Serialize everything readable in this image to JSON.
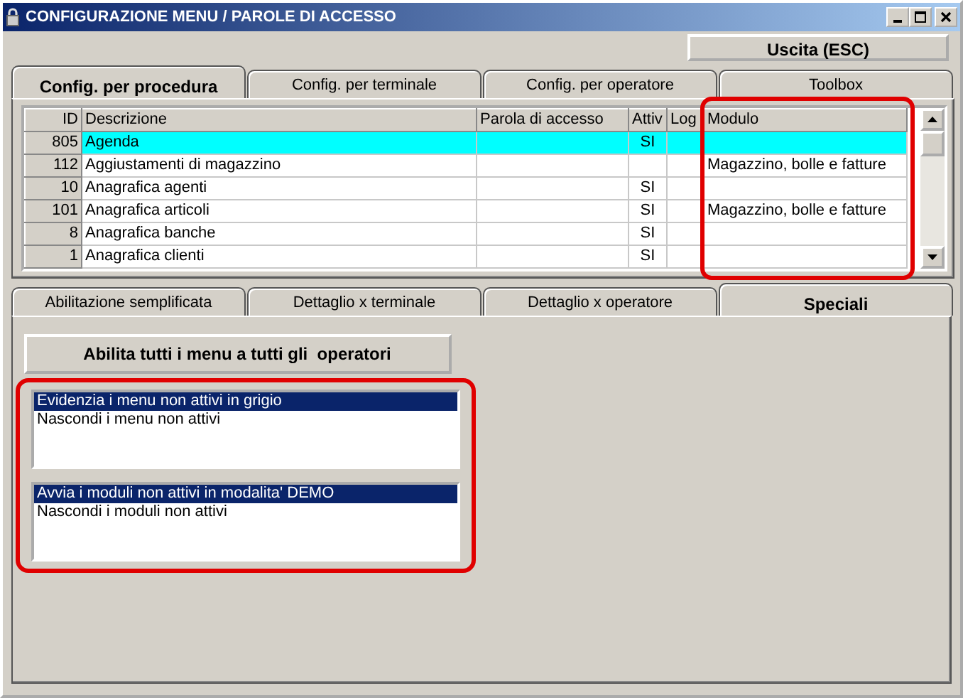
{
  "window": {
    "title": "CONFIGURAZIONE MENU / PAROLE DI ACCESSO"
  },
  "exit_button": {
    "label": "Uscita (ESC)"
  },
  "tabs": [
    {
      "label": "Config. per procedura",
      "selected": true
    },
    {
      "label": "Config. per terminale",
      "selected": false
    },
    {
      "label": "Config. per operatore",
      "selected": false
    },
    {
      "label": "Toolbox",
      "selected": false
    }
  ],
  "table": {
    "columns": [
      {
        "label": "ID",
        "highlighted": false
      },
      {
        "label": "Descrizione",
        "highlighted": false
      },
      {
        "label": "Parola di accesso",
        "highlighted": false
      },
      {
        "label": "Attiv",
        "highlighted": false
      },
      {
        "label": "Log",
        "highlighted": false
      },
      {
        "label": "Modulo",
        "highlighted": true
      }
    ],
    "rows": [
      {
        "id": "805",
        "description": "Agenda",
        "active": "SI",
        "selected": true
      },
      {
        "id": "112",
        "description": "Aggiustamenti di magazzino",
        "module": "Magazzino, bolle e fatture",
        "selected": false
      },
      {
        "id": "10",
        "description": "Anagrafica agenti",
        "active": "SI",
        "selected": false
      },
      {
        "id": "101",
        "description": "Anagrafica articoli",
        "active": "SI",
        "module": "Magazzino, bolle e fatture",
        "selected": false
      },
      {
        "id": "8",
        "description": "Anagrafica banche",
        "active": "SI",
        "selected": false
      },
      {
        "id": "1",
        "description": "Anagrafica clienti",
        "active": "SI",
        "selected": false
      }
    ]
  },
  "sub_tabs": [
    {
      "label": "Abilitazione semplificata",
      "selected": false
    },
    {
      "label": "Dettaglio x terminale",
      "selected": false
    },
    {
      "label": "Dettaglio x operatore",
      "selected": false
    },
    {
      "label": "Speciali",
      "selected": true
    }
  ],
  "specials": {
    "button": "Abilita tutti i menu a tutti gli  operatori",
    "highlighted": true,
    "lists": [
      {
        "items": [
          {
            "label": "Evidenzia i menu non attivi in grigio",
            "selected": true
          },
          {
            "label": "Nascondi i menu non attivi",
            "selected": false
          }
        ]
      },
      {
        "items": [
          {
            "label": "Avvia i moduli non attivi in modalita' DEMO",
            "selected": true
          },
          {
            "label": "Nascondi i moduli non attivi",
            "selected": false
          }
        ]
      }
    ]
  }
}
